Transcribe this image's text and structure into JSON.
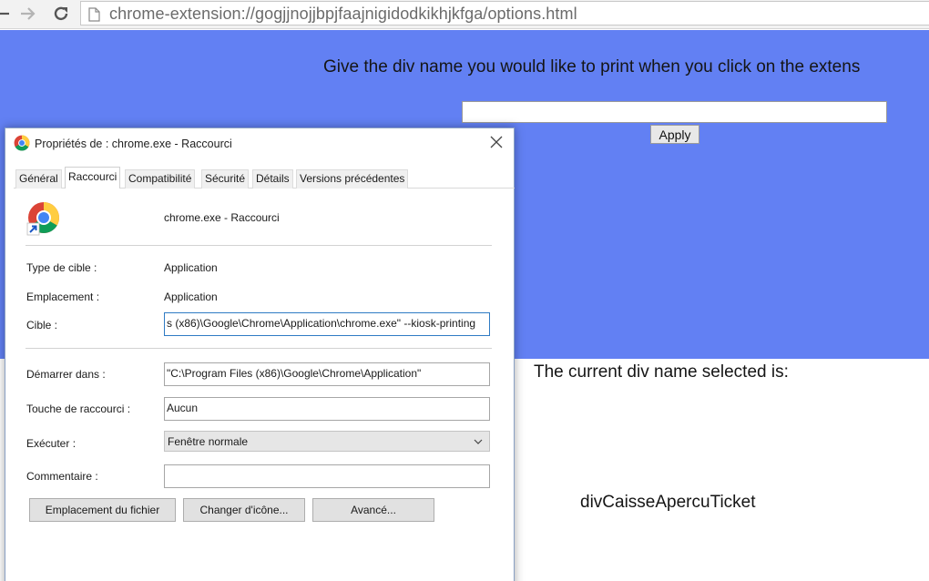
{
  "browser": {
    "url": "chrome-extension://gogjjnojjbpjfaajnigidodkikhjkfga/options.html",
    "icons": [
      "back-icon",
      "forward-icon",
      "reload-icon",
      "page-icon"
    ]
  },
  "options_page": {
    "prompt": "Give the div name you would like to print when you click on the extens",
    "input_value": "",
    "apply_label": "Apply",
    "current_label": "The current div name selected is:",
    "current_value": "divCaisseApercuTicket",
    "colors": {
      "background": "#6280f3",
      "text": "#151515"
    }
  },
  "dialog": {
    "title": "Propriétés de : chrome.exe - Raccourci",
    "tabs": [
      {
        "label": "Général",
        "active": false
      },
      {
        "label": "Raccourci",
        "active": true
      },
      {
        "label": "Compatibilité",
        "active": false
      },
      {
        "label": "Sécurité",
        "active": false
      },
      {
        "label": "Détails",
        "active": false
      },
      {
        "label": "Versions précédentes",
        "active": false
      }
    ],
    "shortcut_name": "chrome.exe - Raccourci",
    "fields": {
      "target_type_label": "Type de cible :",
      "target_type_value": "Application",
      "location_label": "Emplacement :",
      "location_value": "Application",
      "target_label": "Cible :",
      "target_value": "s (x86)\\Google\\Chrome\\Application\\chrome.exe\" --kiosk-printing",
      "start_in_label": "Démarrer dans :",
      "start_in_value": "\"C:\\Program Files (x86)\\Google\\Chrome\\Application\"",
      "shortcut_key_label": "Touche de raccourci :",
      "shortcut_key_value": "Aucun",
      "run_label": "Exécuter :",
      "run_value": "Fenêtre normale",
      "comment_label": "Commentaire :",
      "comment_value": ""
    },
    "buttons": {
      "open_location": "Emplacement du fichier",
      "change_icon": "Changer d'icône...",
      "advanced": "Avancé..."
    }
  }
}
